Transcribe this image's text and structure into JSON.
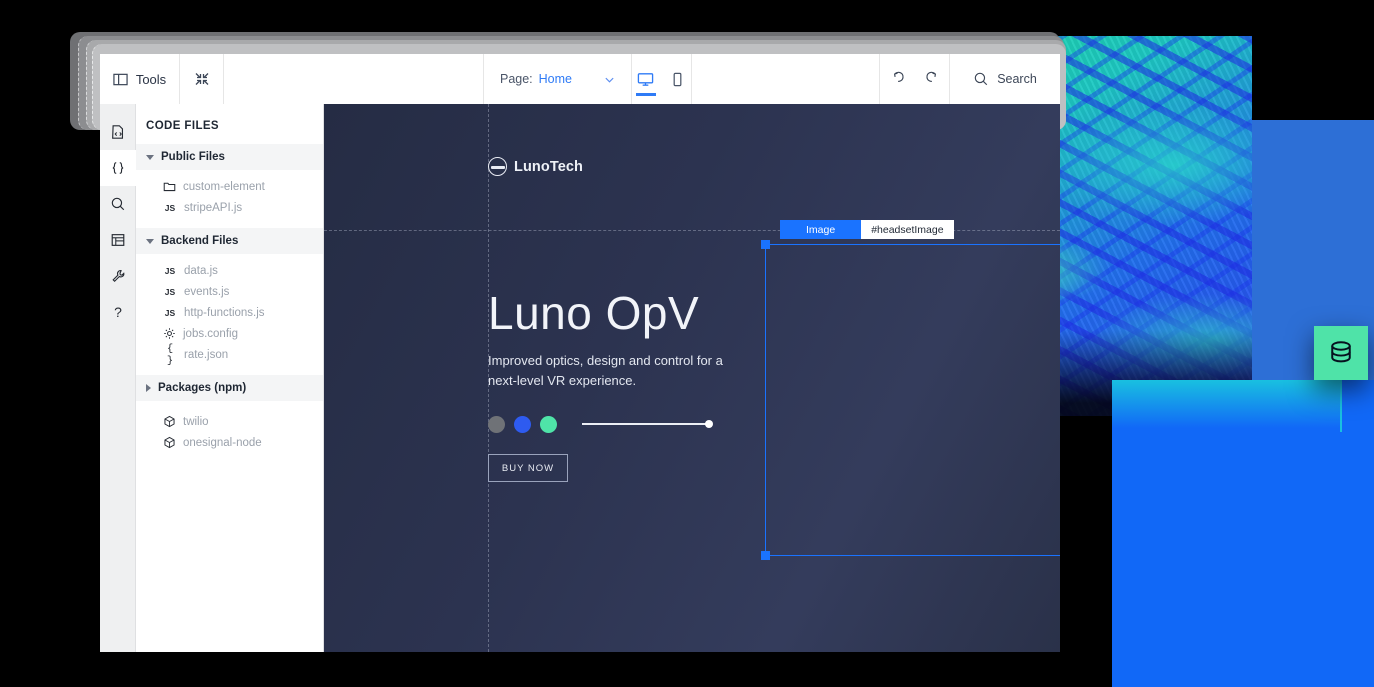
{
  "toolbar": {
    "tools_label": "Tools",
    "tools_icon": "panel-layout-icon",
    "collapse_icon": "collapse-arrows-icon",
    "page_keyword": "Page:",
    "page_value": "Home",
    "page_dropdown_icon": "chevron-down-icon",
    "desktop_icon": "desktop-monitor-icon",
    "mobile_icon": "mobile-phone-icon",
    "undo_icon": "undo-arrow-icon",
    "redo_icon": "redo-arrow-icon",
    "search_icon": "search-icon",
    "search_label": "Search"
  },
  "icon_rail": [
    {
      "name": "code-file-icon",
      "active": false
    },
    {
      "name": "curly-braces-icon",
      "active": true
    },
    {
      "name": "search-icon",
      "active": false
    },
    {
      "name": "database-panel-icon",
      "active": false
    },
    {
      "name": "wrench-icon",
      "active": false
    },
    {
      "name": "help-question-icon",
      "active": false
    }
  ],
  "file_panel": {
    "title": "CODE FILES",
    "groups": [
      {
        "label": "Public Files",
        "expanded": true,
        "files": [
          {
            "name": "custom-element",
            "icon": "folder-icon"
          },
          {
            "name": "stripeAPI.js",
            "icon": "js-icon"
          }
        ]
      },
      {
        "label": "Backend Files",
        "expanded": true,
        "files": [
          {
            "name": "data.js",
            "icon": "js-icon"
          },
          {
            "name": "events.js",
            "icon": "js-icon"
          },
          {
            "name": "http-functions.js",
            "icon": "js-icon"
          },
          {
            "name": "jobs.config",
            "icon": "gear-icon"
          },
          {
            "name": "rate.json",
            "icon": "json-icon"
          }
        ]
      },
      {
        "label": "Packages (npm)",
        "expanded": false,
        "files": [
          {
            "name": "twilio",
            "icon": "package-icon"
          },
          {
            "name": "onesignal-node",
            "icon": "package-icon"
          }
        ]
      }
    ]
  },
  "canvas": {
    "logo_text": "LunoTech",
    "logo_icon": "luno-circle-logo-icon",
    "menu_icon": "hamburger-menu-icon",
    "hero_title": "Luno OpV",
    "hero_subtitle": "Improved optics, design and control for a next-level VR experience.",
    "swatches": [
      {
        "name": "gray",
        "color": "#6f7277"
      },
      {
        "name": "blue",
        "color": "#2e5bf0"
      },
      {
        "name": "green",
        "color": "#4fe3a8"
      }
    ],
    "slider_value": 100,
    "buy_label": "BUY NOW"
  },
  "selection": {
    "type_label": "Image",
    "id_label": "#headsetImage",
    "accent_color": "#1a73ff"
  },
  "decor": {
    "db_badge_icon": "database-icon",
    "db_badge_color": "#4fe3a8"
  }
}
